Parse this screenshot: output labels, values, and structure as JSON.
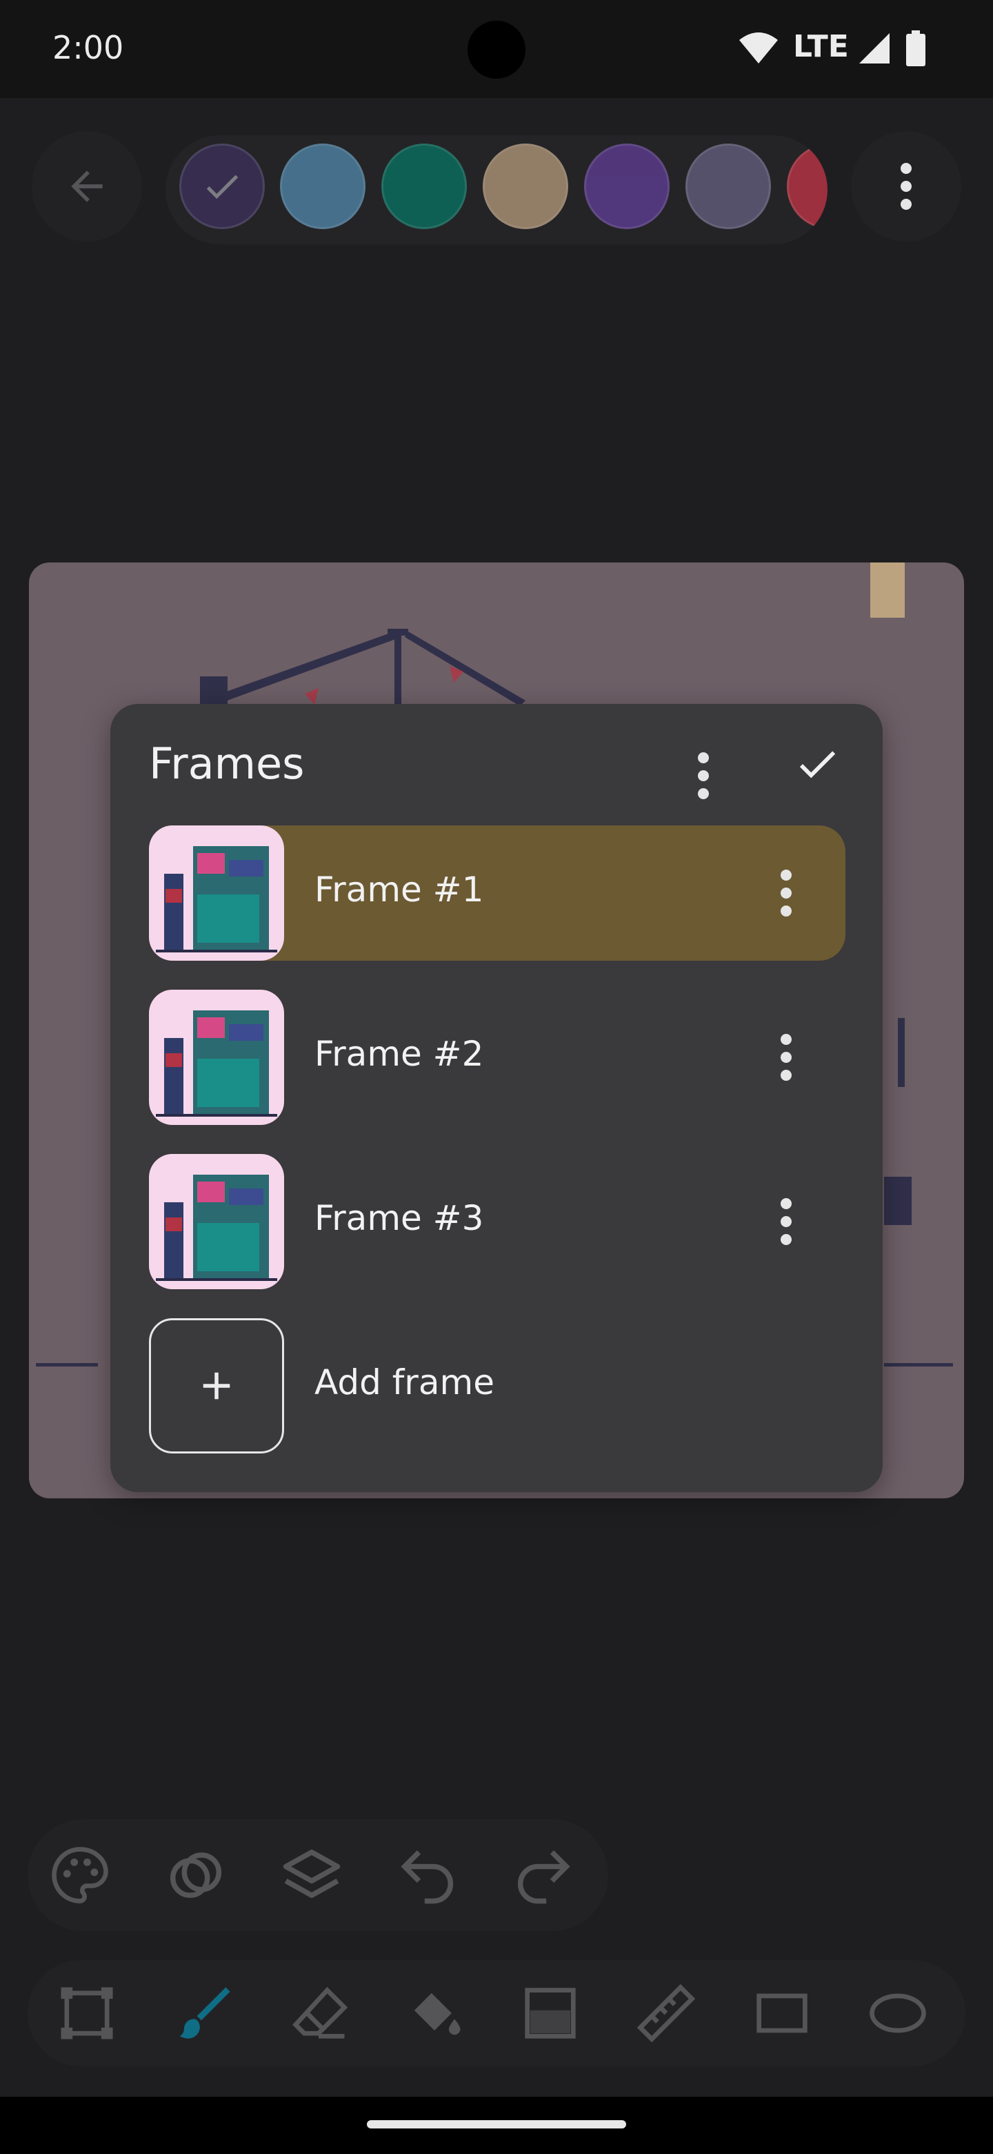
{
  "status_bar": {
    "time": "2:00",
    "network": "LTE"
  },
  "palette": {
    "colors": [
      "#3b3158",
      "#4d7d9e",
      "#0c6b5d",
      "#a68d72",
      "#5a3b8a",
      "#5e5a78",
      "#b23343"
    ],
    "selected_index": 0
  },
  "dialog": {
    "title": "Frames",
    "frames": [
      {
        "label": "Frame #1",
        "selected": true
      },
      {
        "label": "Frame #2",
        "selected": false
      },
      {
        "label": "Frame #3",
        "selected": false
      }
    ],
    "add_label": "Add frame",
    "selected_color": "#6c5a32"
  },
  "toolbar_top": [
    "palette-icon",
    "blend-icon",
    "layers-icon",
    "undo-icon",
    "redo-icon"
  ],
  "toolbar_bottom": [
    "select-icon",
    "brush-icon",
    "eraser-icon",
    "fill-icon",
    "dither-icon",
    "ruler-icon",
    "rectangle-icon",
    "ellipse-icon"
  ],
  "active_tool": "brush-icon",
  "accent": "#0f6d86"
}
